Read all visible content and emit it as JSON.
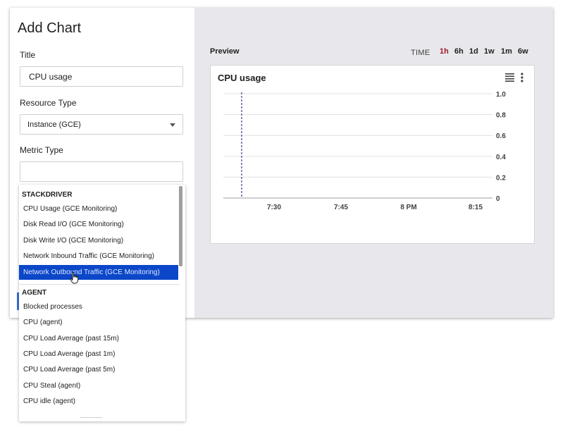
{
  "dialog": {
    "title": "Add Chart",
    "title_label": "Title",
    "title_value": "CPU usage",
    "resource_type_label": "Resource Type",
    "resource_type_value": "Instance (GCE)",
    "metric_type_label": "Metric Type",
    "metric_type_value": ""
  },
  "preview": {
    "label": "Preview",
    "time_label": "TIME",
    "time_options": [
      "1h",
      "6h",
      "1d",
      "1w",
      "1m",
      "6w"
    ],
    "active_time": "1h",
    "accent_color": "#a3152a"
  },
  "chart_data": {
    "type": "line",
    "title": "CPU usage",
    "xlabel": "",
    "ylabel": "",
    "x_ticks": [
      "7:30",
      "7:45",
      "8 PM",
      "8:15"
    ],
    "y_ticks": [
      "1.0",
      "0.8",
      "0.6",
      "0.4",
      "0.2",
      "0"
    ],
    "ylim": [
      0,
      1
    ],
    "grid": true,
    "series": [],
    "marker_line_style": "dashed",
    "marker_line_color": "#3c3c8c"
  },
  "dropdown": {
    "groups": [
      {
        "heading": "STACKDRIVER",
        "items": [
          "CPU Usage (GCE Monitoring)",
          "Disk Read I/O (GCE Monitoring)",
          "Disk Write I/O (GCE Monitoring)",
          "Network Inbound Traffic (GCE Monitoring)",
          "Network Outbound Traffic (GCE Monitoring)"
        ]
      },
      {
        "heading": "AGENT",
        "items": [
          "Blocked processes",
          "CPU (agent)",
          "CPU Load Average (past 15m)",
          "CPU Load Average (past 1m)",
          "CPU Load Average (past 5m)",
          "CPU Steal (agent)",
          "CPU idle (agent)"
        ]
      }
    ],
    "selected_item": "Network Outbound Traffic (GCE Monitoring)",
    "selected_color": "#0b47c8"
  },
  "icons": {
    "legend": "legend-list-icon",
    "more": "more-vert-icon",
    "caret": "caret-down-icon",
    "cursor": "hand-pointer-icon"
  }
}
